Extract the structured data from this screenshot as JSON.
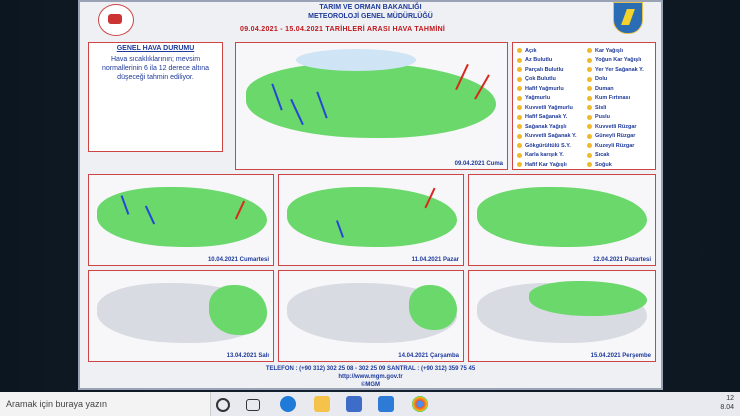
{
  "header": {
    "line1": "TARIM VE ORMAN BAKANLIĞI",
    "line2": "METEOROLOJİ GENEL MÜDÜRLÜĞÜ",
    "title": "09.04.2021 - 15.04.2021  TARİHLERİ ARASI HAVA TAHMİNİ"
  },
  "general": {
    "heading": "GENEL HAVA DURUMU",
    "text": "Hava sıcaklıklarının; mevsim normallerinin 6 ila 12 derece altına düşeceği tahmin ediliyor."
  },
  "maps": [
    {
      "label": "09.04.2021 Cuma"
    },
    {
      "label": "10.04.2021 Cumartesi"
    },
    {
      "label": "11.04.2021 Pazar"
    },
    {
      "label": "12.04.2021 Pazartesi"
    },
    {
      "label": "13.04.2021 Salı"
    },
    {
      "label": "14.04.2021 Çarşamba"
    },
    {
      "label": "15.04.2021 Perşembe"
    }
  ],
  "legend": {
    "left": [
      "Açık",
      "Az Bulutlu",
      "Parçalı Bulutlu",
      "Çok Bulutlu",
      "Hafif Yağmurlu",
      "Yağmurlu",
      "Kuvvetli Yağmurlu",
      "Hafif Sağanak Y.",
      "Sağanak Yağışlı",
      "Kuvvetli Sağanak Y.",
      "Gökgürültülü S.Y.",
      "Karla karışık Y.",
      "Hafif Kar Yağışlı"
    ],
    "right": [
      "Kar Yağışlı",
      "Yoğun Kar Yağışlı",
      "Yer Yer Sağanak Y.",
      "Dolu",
      "Duman",
      "Kum Fırtınası",
      "Sisli",
      "Puslu",
      "Kuvvetli Rüzgar",
      "Güneyli Rüzgar",
      "Kuzeyli Rüzgar",
      "Sıcak",
      "Soğuk"
    ]
  },
  "footer": {
    "phone": "TELEFON : (+90 312) 302 25 08 - 302 25 09  SANTRAL : (+90 312) 359 75 45",
    "url": "http://www.mgm.gov.tr",
    "copyright": "©MGM"
  },
  "taskbar": {
    "search_placeholder": "Aramak için buraya yazın",
    "time": "12",
    "date": "8.04"
  },
  "colors": {
    "land": "#6bd86b",
    "accent": "#1e3a9a",
    "border": "#cc4444",
    "cold_arrow": "#2447d8",
    "warm_arrow": "#d62a1f"
  }
}
